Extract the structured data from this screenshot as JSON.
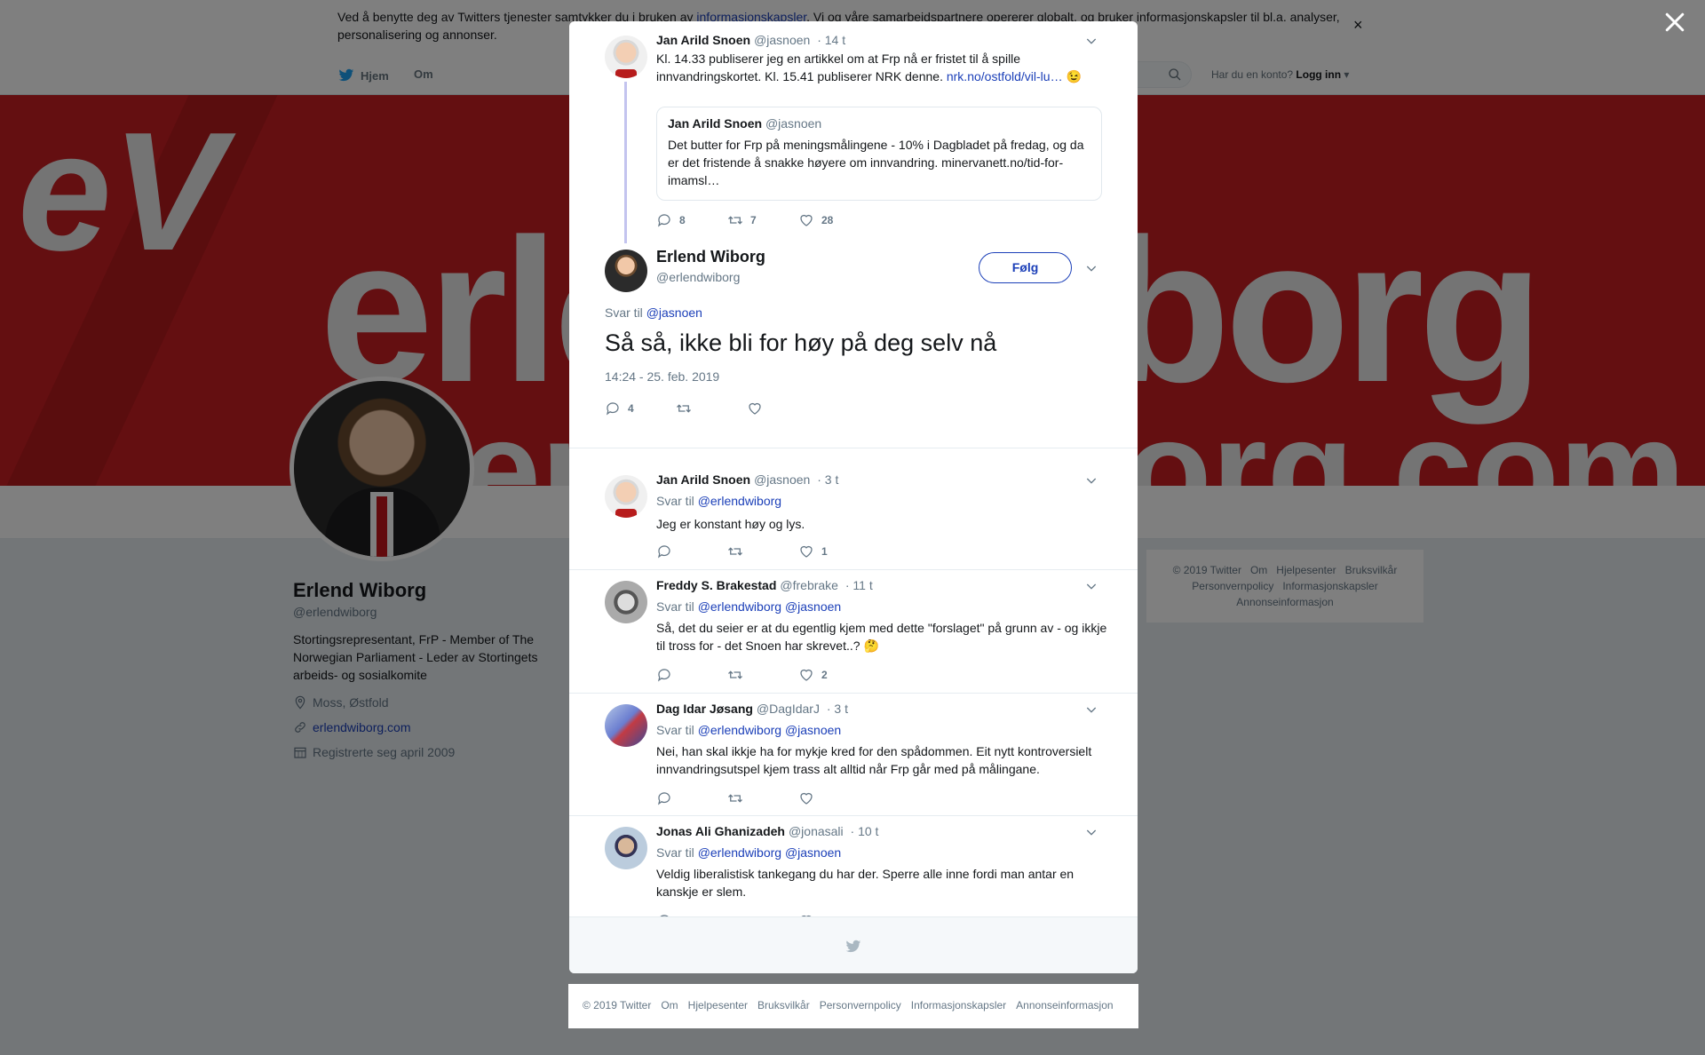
{
  "cookie": {
    "text_before": "Ved å benytte deg av Twitters tjenester samtykker du i bruken av ",
    "link": "informasjonskapsler",
    "text_after": ". Vi og våre samarbeidspartnere opererer globalt, og bruker informasjonskapsler til bl.a. analyser, personalisering og annonser."
  },
  "nav": {
    "home": "Hjem",
    "about": "Om",
    "login_prompt": "Har du en konto?",
    "login": "Logg inn"
  },
  "banner": {
    "word": "erlendwiborg",
    "word2": "erlendwiborg.com",
    "logo": "eV"
  },
  "profile": {
    "name": "Erlend Wiborg",
    "handle": "@erlendwiborg",
    "bio": "Stortingsrepresentant, FrP - Member of The Norwegian Parliament - Leder av Stortingets arbeids- og sosialkomite",
    "location": "Moss, Østfold",
    "website": "erlendwiborg.com",
    "joined": "Registrerte seg april 2009"
  },
  "side_footer": [
    "© 2019 Twitter",
    "Om",
    "Hjelpesenter",
    "Bruksvilkår",
    "Personvernpolicy",
    "Informasjonskapsler",
    "Annonseinformasjon"
  ],
  "modal": {
    "parent": {
      "name": "Jan Arild Snoen",
      "handle": "@jasnoen",
      "time": "· 14 t",
      "text": "Kl. 14.33 publiserer jeg en artikkel om at Frp nå er fristet til å spille innvandringskortet. Kl. 15.41 publiserer NRK denne. ",
      "link": "nrk.no/ostfold/vil-lu…",
      "emoji": "😉",
      "quote": {
        "name": "Jan Arild Snoen",
        "handle": "@jasnoen",
        "text": "Det butter for Frp på meningsmålingene - 10% i Dagbladet på fredag, og da er det fristende å snakke høyere om innvandring. minervanett.no/tid-for-imamsl…"
      },
      "replies": "8",
      "retweets": "7",
      "likes": "28"
    },
    "main": {
      "name": "Erlend Wiborg",
      "handle": "@erlendwiborg",
      "follow": "Følg",
      "reply_prefix": "Svar til",
      "reply_to": "@jasnoen",
      "text": "Så så, ikke bli for høy på deg selv nå",
      "timestamp": "14:24 - 25. feb. 2019",
      "replies": "4",
      "retweets": "",
      "likes": ""
    },
    "replies": [
      {
        "name": "Jan Arild Snoen",
        "handle": "@jasnoen",
        "time": "· 3 t",
        "reply_prefix": "Svar til",
        "reply_to": "@erlendwiborg",
        "reply_to2": "",
        "text": "Jeg er konstant høy og lys.",
        "emoji": "",
        "replies": "",
        "retweets": "",
        "likes": "1"
      },
      {
        "name": "Freddy S. Brakestad",
        "handle": "@frebrake",
        "time": "· 11 t",
        "reply_prefix": "Svar til",
        "reply_to": "@erlendwiborg",
        "reply_to2": "@jasnoen",
        "text": "Så, det du seier er at du egentlig kjem med dette \"forslaget\" på grunn av - og ikkje til tross for - det Snoen har skrevet..? ",
        "emoji": "🤔",
        "replies": "",
        "retweets": "",
        "likes": "2"
      },
      {
        "name": "Dag Idar Jøsang",
        "handle": "@DagIdarJ",
        "time": "· 3 t",
        "reply_prefix": "Svar til",
        "reply_to": "@erlendwiborg",
        "reply_to2": "@jasnoen",
        "text": "Nei, han skal ikkje ha for mykje kred for den spådommen. Eit nytt kontroversielt innvandringsutspel kjem trass alt alltid når Frp går med på målingane.",
        "emoji": "",
        "replies": "",
        "retweets": "",
        "likes": ""
      },
      {
        "name": "Jonas Ali Ghanizadeh",
        "handle": "@jonasali",
        "time": "· 10 t",
        "reply_prefix": "Svar til",
        "reply_to": "@erlendwiborg",
        "reply_to2": "@jasnoen",
        "text": "Veldig liberalistisk tankegang du har der. Sperre alle inne fordi man antar en kanskje er slem.",
        "emoji": "",
        "replies": "",
        "retweets": "",
        "likes": ""
      }
    ]
  },
  "footer": [
    "© 2019 Twitter",
    "Om",
    "Hjelpesenter",
    "Bruksvilkår",
    "Personvernpolicy",
    "Informasjonskapsler",
    "Annonseinformasjon"
  ],
  "colors": {
    "link": "#1b3fb8",
    "banner": "#c81e22",
    "muted": "#657786"
  },
  "icons": [
    "twitter-bird-icon",
    "search-icon",
    "close-icon",
    "chevron-down-icon",
    "reply-icon",
    "retweet-icon",
    "like-icon",
    "location-icon",
    "link-icon",
    "calendar-icon"
  ]
}
